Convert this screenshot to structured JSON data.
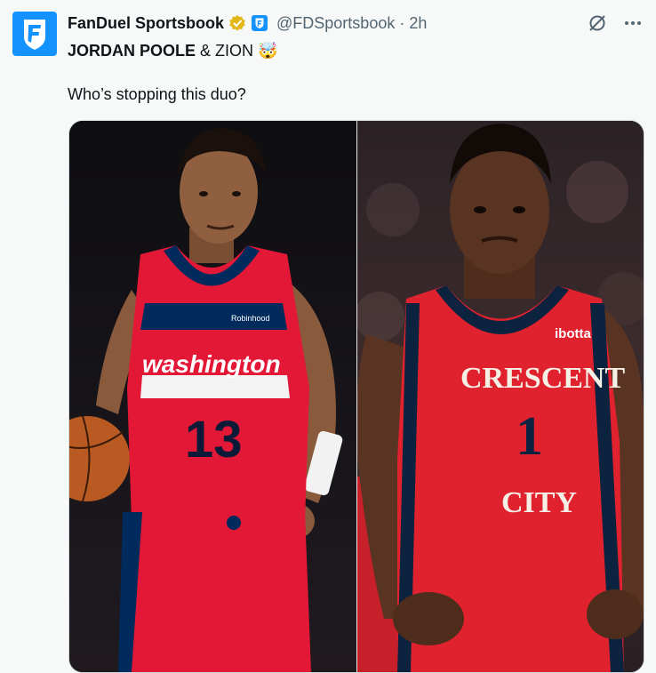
{
  "tweet": {
    "author_name": "FanDuel Sportsbook",
    "handle": "@FDSportsbook",
    "separator": "·",
    "time": "2h",
    "headline_bold": "JORDAN POOLE",
    "headline_rest": " & ZION ",
    "headline_emoji": "🤯",
    "body": "Who’s stopping this duo?"
  },
  "media": {
    "left_player": {
      "jersey_text": "washington",
      "jersey_number": "13",
      "sponsor": "Robinhood"
    },
    "right_player": {
      "jersey_text_1": "CRESCENT",
      "jersey_number": "1",
      "jersey_text_2": "CITY",
      "sponsor": "ibotta"
    }
  },
  "colors": {
    "brand_blue": "#1493ff",
    "verified_gold": "#e2b719",
    "wizards_red": "#e31837",
    "wizards_navy": "#002b5c",
    "pelicans_red": "#e0212e",
    "pelicans_navy": "#0c2340"
  },
  "icons": {
    "avatar": "fanduel-shield-logo",
    "verified": "verified-gold-check-icon",
    "affiliate": "fanduel-affiliate-badge-icon",
    "grok": "grok-icon",
    "more": "more-dots-icon"
  }
}
